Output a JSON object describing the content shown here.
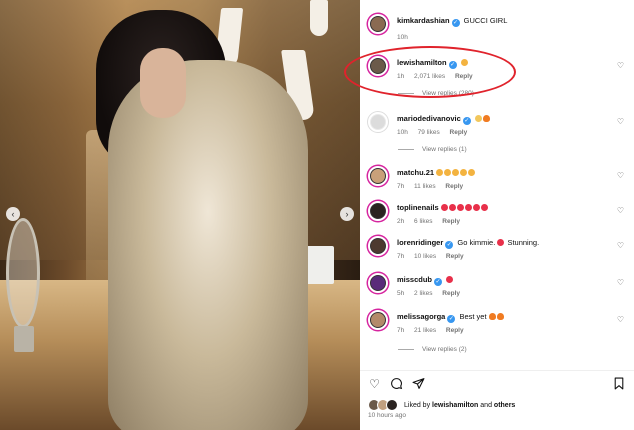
{
  "post": {
    "caption": {
      "user": "kimkardashian",
      "text": "GUCCI GIRL",
      "time": "10h"
    }
  },
  "comments": [
    {
      "user": "lewishamilton",
      "verified": true,
      "text": "",
      "emojis": [
        "smile"
      ],
      "time": "1h",
      "likes": "2,071 likes",
      "reply": "Reply",
      "view_replies": "View replies (280)",
      "avatar_color": "#6b5a4a"
    },
    {
      "user": "mariodedivanovic",
      "verified": true,
      "text": "",
      "emojis": [
        "clap",
        "fire"
      ],
      "time": "10h",
      "likes": "79 likes",
      "reply": "Reply",
      "view_replies": "View replies (1)",
      "avatar_color": "#dcdcdc"
    },
    {
      "user": "matchu.21",
      "verified": false,
      "text": "",
      "emojis": [
        "smile",
        "smile",
        "smile",
        "smile",
        "smile"
      ],
      "time": "7h",
      "likes": "11 likes",
      "reply": "Reply",
      "view_replies": "",
      "avatar_color": "#c9a07a"
    },
    {
      "user": "toplinenails",
      "verified": false,
      "text": "",
      "emojis": [
        "heart",
        "heart",
        "heart",
        "heart",
        "heart",
        "heart"
      ],
      "time": "2h",
      "likes": "6 likes",
      "reply": "Reply",
      "view_replies": "",
      "avatar_color": "#2a2320"
    },
    {
      "user": "lorenridinger",
      "verified": true,
      "text": "Go kimmie. ",
      "text_after": " Stunning.",
      "emojis": [
        "heart"
      ],
      "time": "7h",
      "likes": "10 likes",
      "reply": "Reply",
      "view_replies": "",
      "avatar_color": "#4d3a30"
    },
    {
      "user": "misscdub",
      "verified": true,
      "text": "",
      "emojis": [
        "heart"
      ],
      "time": "5h",
      "likes": "2 likes",
      "reply": "Reply",
      "view_replies": "",
      "avatar_color": "#5a2b7a"
    },
    {
      "user": "melissagorga",
      "verified": true,
      "text": "Best yet ",
      "emojis": [
        "fire",
        "fire"
      ],
      "time": "7h",
      "likes": "21 likes",
      "reply": "Reply",
      "view_replies": "View replies (2)",
      "avatar_color": "#b38a6a"
    }
  ],
  "footer": {
    "liked_prefix": "Liked by",
    "liked_user": "lewishamilton",
    "liked_and": "and",
    "liked_others": "others",
    "time_ago": "10 hours ago"
  },
  "icons": {
    "like": "heart-outline-icon",
    "comment": "comment-bubble-icon",
    "share": "send-icon",
    "save": "bookmark-icon"
  },
  "colors": {
    "highlight": "#e0232c",
    "verified": "#3897f0",
    "story_ring": "#d6249f"
  }
}
